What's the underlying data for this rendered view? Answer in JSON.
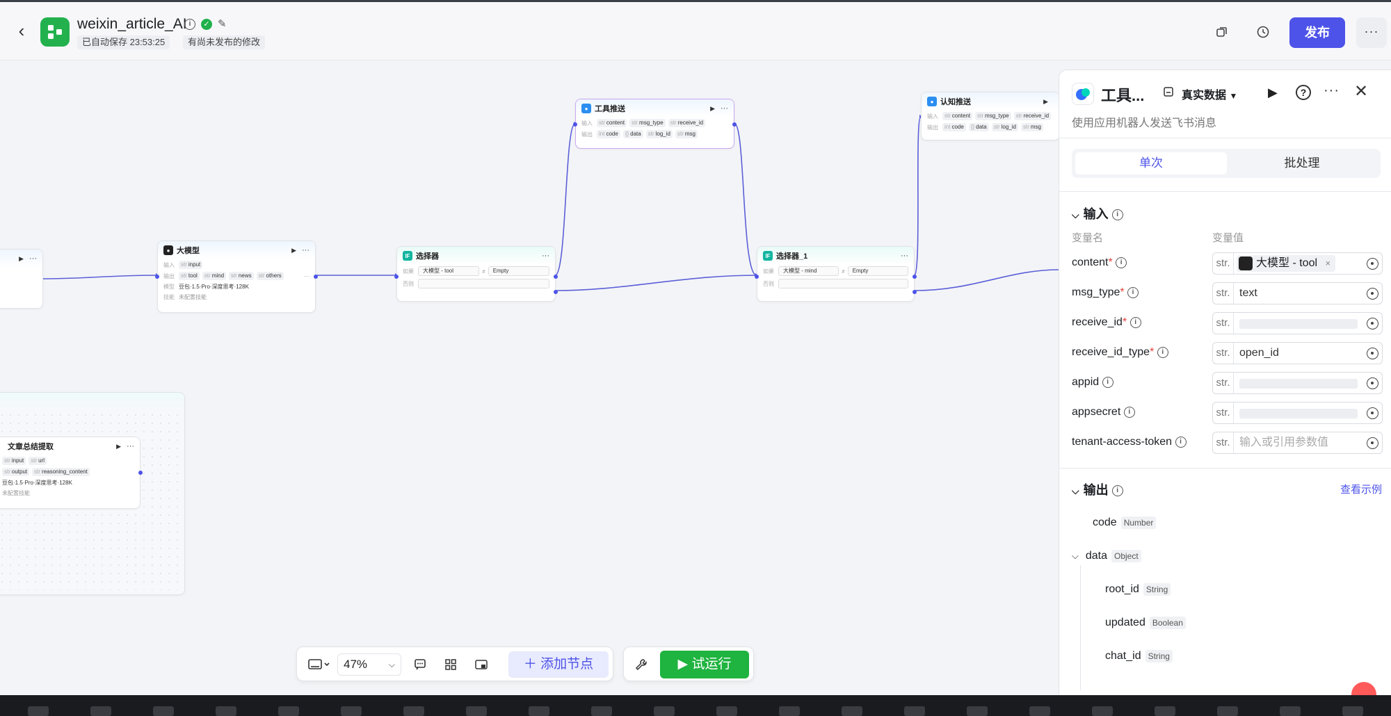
{
  "header": {
    "title": "weixin_article_AI",
    "autosave": "已自动保存 23:53:25",
    "unpublished": "有尚未发布的修改",
    "publish_label": "发布",
    "more_label": "···"
  },
  "nodes": {
    "llm": {
      "title": "大模型",
      "in_label": "输入",
      "in_tag": "input",
      "out_label": "输出",
      "out_tags": [
        "tool",
        "mind",
        "news",
        "others"
      ],
      "model_label": "模型",
      "model": "豆包·1.5·Pro·深度思考·128K",
      "skill_label": "技能",
      "skill": "未配置技能"
    },
    "selector": {
      "title": "选择器",
      "if_label": "如果",
      "cond_left": "大模型 - tool",
      "cond_op": "≠",
      "cond_right": "Empty",
      "else_label": "否则"
    },
    "selector1": {
      "title": "选择器_1",
      "if_label": "如果",
      "cond_left": "大模型 - mind",
      "cond_op": "≠",
      "cond_right": "Empty",
      "else_label": "否则"
    },
    "tool_push": {
      "title": "工具推送",
      "in_label": "输入",
      "in_tags": [
        "content",
        "msg_type",
        "receive_id"
      ],
      "out_label": "输出",
      "out_tags": [
        "code",
        "data",
        "log_id",
        "msg"
      ]
    },
    "cog_push": {
      "title": "认知推送",
      "in_label": "输入",
      "in_tags": [
        "content",
        "msg_type",
        "receive_id"
      ],
      "out_label": "输出",
      "out_tags": [
        "code",
        "data",
        "log_id",
        "msg"
      ]
    },
    "article": {
      "title": "文章总结提取",
      "in_tags": [
        "input",
        "url"
      ],
      "out_tags": [
        "output",
        "reasoning_content"
      ],
      "model": "豆包·1.5·Pro·深度思考·128K",
      "skill": "未配置技能"
    }
  },
  "toolbar": {
    "zoom": "47%",
    "add_node": "添加节点",
    "run": "试运行"
  },
  "panel": {
    "title": "工具...",
    "data_mode": "真实数据",
    "description": "使用应用机器人发送飞书消息",
    "tab_single": "单次",
    "tab_batch": "批处理",
    "input_section": "输入",
    "col_var_name": "变量名",
    "col_var_value": "变量值",
    "str_label": "str.",
    "vars": [
      {
        "name": "content",
        "required": "*",
        "value": "大模型 - tool"
      },
      {
        "name": "msg_type",
        "required": "*",
        "value": "text"
      },
      {
        "name": "receive_id",
        "required": "*",
        "value": ""
      },
      {
        "name": "receive_id_type",
        "required": "*",
        "value": "open_id"
      },
      {
        "name": "appid",
        "required": "",
        "value": ""
      },
      {
        "name": "appsecret",
        "required": "",
        "value": ""
      },
      {
        "name": "tenant-access-token",
        "required": "",
        "placeholder": "输入或引用参数值"
      }
    ],
    "output_section": "输出",
    "view_example": "查看示例",
    "outputs": [
      {
        "name": "code",
        "type": "Number"
      },
      {
        "name": "data",
        "type": "Object"
      },
      {
        "name": "root_id",
        "type": "String"
      },
      {
        "name": "updated",
        "type": "Boolean"
      },
      {
        "name": "chat_id",
        "type": "String"
      }
    ]
  }
}
